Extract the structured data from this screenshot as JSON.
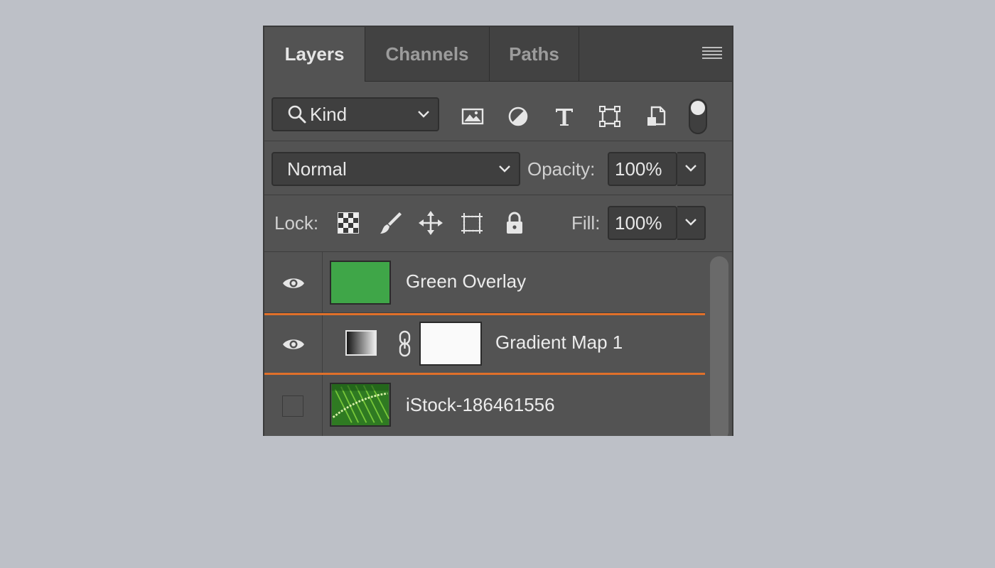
{
  "tabs": [
    {
      "label": "Layers",
      "active": true
    },
    {
      "label": "Channels",
      "active": false
    },
    {
      "label": "Paths",
      "active": false
    }
  ],
  "filter": {
    "kind_label": "Kind",
    "icons": [
      "image-filter-icon",
      "adjustment-filter-icon",
      "type-filter-icon",
      "shape-filter-icon",
      "smart-object-filter-icon"
    ]
  },
  "blend": {
    "mode": "Normal",
    "opacity_label": "Opacity:",
    "opacity_value": "100%"
  },
  "lock": {
    "label": "Lock:",
    "icons": [
      "lock-transparent-pixels-icon",
      "lock-image-pixels-icon",
      "lock-position-icon",
      "lock-artboard-icon",
      "lock-all-icon"
    ],
    "fill_label": "Fill:",
    "fill_value": "100%"
  },
  "layers": [
    {
      "name": "Green Overlay",
      "visible": true,
      "selected": false,
      "thumb_color": "#3fa648"
    },
    {
      "name": "Gradient Map 1",
      "visible": true,
      "selected": true,
      "adjustment": true
    },
    {
      "name": "iStock-186461556",
      "visible": false,
      "selected": false
    }
  ],
  "colors": {
    "accent_selection": "#e0702a",
    "panel_bg": "#535353",
    "page_bg": "#bdc0c7"
  }
}
